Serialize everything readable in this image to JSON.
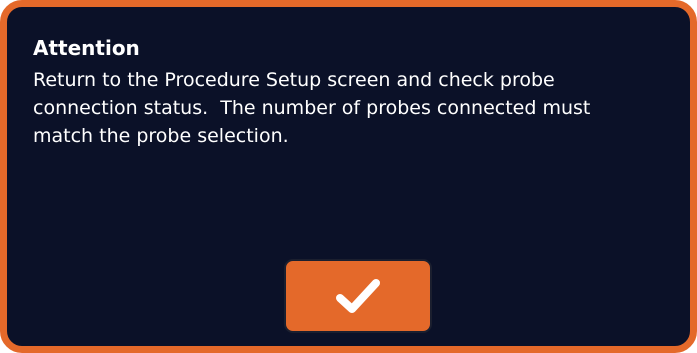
{
  "dialog": {
    "title": "Attention",
    "message_lines": [
      "Return to the Procedure Setup screen and check probe",
      "connection status.  The number of probes connected must",
      "match the probe selection."
    ],
    "confirm_button": {
      "icon": "checkmark-icon"
    }
  },
  "colors": {
    "accent": "#e4692a",
    "background": "#0b1128",
    "text": "#ffffff"
  }
}
